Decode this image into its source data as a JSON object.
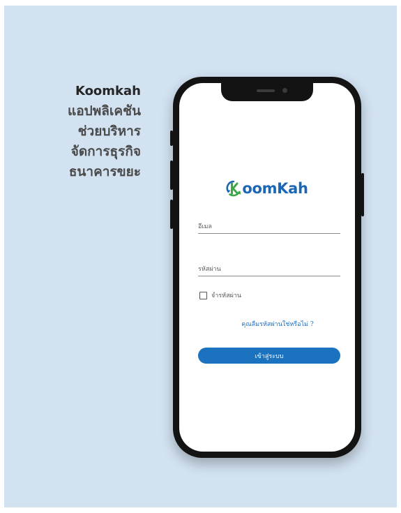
{
  "promo": {
    "title": "Koomkah",
    "lines": [
      "แอปพลิเคชัน",
      "ช่วยบริหาร",
      "จัดการธุรกิจ",
      "ธนาคารขยะ"
    ]
  },
  "app": {
    "logo_text": "oomKah",
    "logo_icon": "recycle-k-logo-icon",
    "email_label": "อีเมล",
    "password_label": "รหัสผ่าน",
    "remember_label": "จำรหัสผ่าน",
    "forgot_link": "คุณลืมรหัสผ่านใช่หรือไม่ ?",
    "login_button": "เข้าสู่ระบบ"
  },
  "colors": {
    "background": "#d2e2f1",
    "brand_blue": "#1b67b6",
    "brand_green": "#3aa845",
    "button": "#1b72bf"
  }
}
